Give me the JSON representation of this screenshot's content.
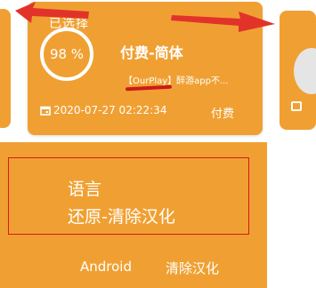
{
  "card": {
    "status": "已选择",
    "progress": "98 %",
    "title": "付费-简体",
    "description": "【OurPlay】醉游app不...",
    "date": "2020-07-27 02:22:34",
    "price": "付费"
  },
  "detail": {
    "language_label": "语言",
    "language_value": "还原-清除汉化",
    "platform": "Android",
    "action": "清除汉化"
  },
  "colors": {
    "accent": "#f0a032",
    "annotation": "#d81a1a"
  },
  "icons": [
    "calendar-icon",
    "progress-ring-icon",
    "arrow-left-annotation",
    "arrow-right-annotation"
  ]
}
